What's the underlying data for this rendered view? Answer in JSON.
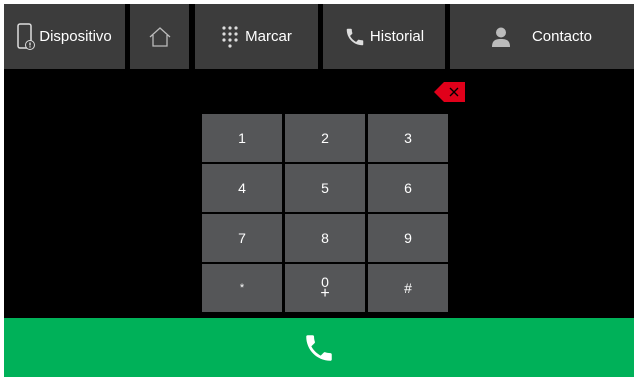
{
  "nav": {
    "device_label": "Dispositivo",
    "dial_label": "Marcar",
    "history_label": "Historial",
    "contact_label": "Contacto",
    "icons": {
      "device": "phone-device-icon",
      "home": "home-icon",
      "dial": "dialpad-icon",
      "history": "phone-handset-icon",
      "contact": "person-icon"
    }
  },
  "backspace": {
    "icon": "backspace-icon",
    "color": "#e0001a"
  },
  "keypad": {
    "keys": [
      {
        "main": "1"
      },
      {
        "main": "2"
      },
      {
        "main": "3"
      },
      {
        "main": "4"
      },
      {
        "main": "5"
      },
      {
        "main": "6"
      },
      {
        "main": "7"
      },
      {
        "main": "8"
      },
      {
        "main": "9"
      },
      {
        "main": "*"
      },
      {
        "main": "0",
        "sub": "+"
      },
      {
        "main": "#"
      }
    ]
  },
  "call": {
    "icon": "phone-call-icon",
    "color": "#00b159"
  },
  "colors": {
    "nav_bg": "#3c3c3c",
    "key_bg": "#555658",
    "screen_bg": "#000000"
  }
}
